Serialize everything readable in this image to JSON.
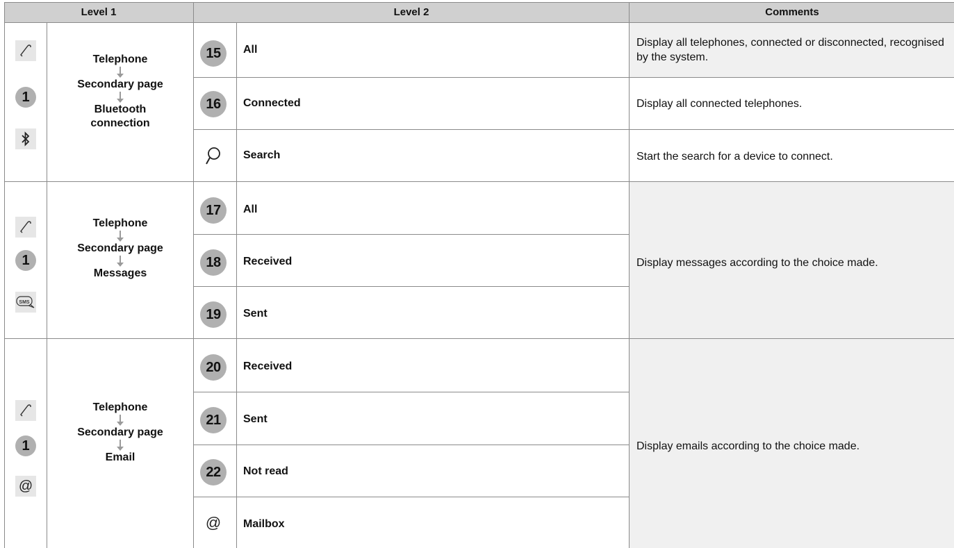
{
  "header": {
    "level1": "Level 1",
    "level2": "Level 2",
    "comments": "Comments"
  },
  "sections": [
    {
      "icons": [
        "phone-handset-icon",
        "one-badge",
        "bluetooth-icon"
      ],
      "badge": "1",
      "path": [
        "Telephone",
        "Secondary page",
        "Bluetooth connection"
      ],
      "rows": [
        {
          "num": "15",
          "label": "All"
        },
        {
          "num": "16",
          "label": "Connected"
        },
        {
          "num": "",
          "icon": "search-icon",
          "label": "Search"
        }
      ],
      "comments": [
        "Display all telephones, connected or disconnected, recognised by the system.",
        "Display all connected telephones.",
        "Start the search for a device to connect."
      ]
    },
    {
      "icons": [
        "phone-handset-icon",
        "one-badge",
        "sms-icon"
      ],
      "badge": "1",
      "sms_icon_text": "SMS",
      "path": [
        "Telephone",
        "Secondary page",
        "Messages"
      ],
      "rows": [
        {
          "num": "17",
          "label": "All"
        },
        {
          "num": "18",
          "label": "Received"
        },
        {
          "num": "19",
          "label": "Sent"
        }
      ],
      "comment": "Display messages according to the choice made."
    },
    {
      "icons": [
        "phone-handset-icon",
        "one-badge",
        "at-sign-icon"
      ],
      "badge": "1",
      "path": [
        "Telephone",
        "Secondary page",
        "Email"
      ],
      "rows": [
        {
          "num": "20",
          "label": "Received"
        },
        {
          "num": "21",
          "label": "Sent"
        },
        {
          "num": "22",
          "label": "Not read"
        },
        {
          "num": "",
          "icon": "at-sign-icon",
          "label": "Mailbox"
        }
      ],
      "comment": "Display emails according to the choice made."
    }
  ],
  "colors": {
    "header_bg": "#d0d0d0",
    "badge_bg": "#b0b0b0",
    "shaded_cell_bg": "#f0f0f0",
    "border": "#8a8a8a"
  }
}
